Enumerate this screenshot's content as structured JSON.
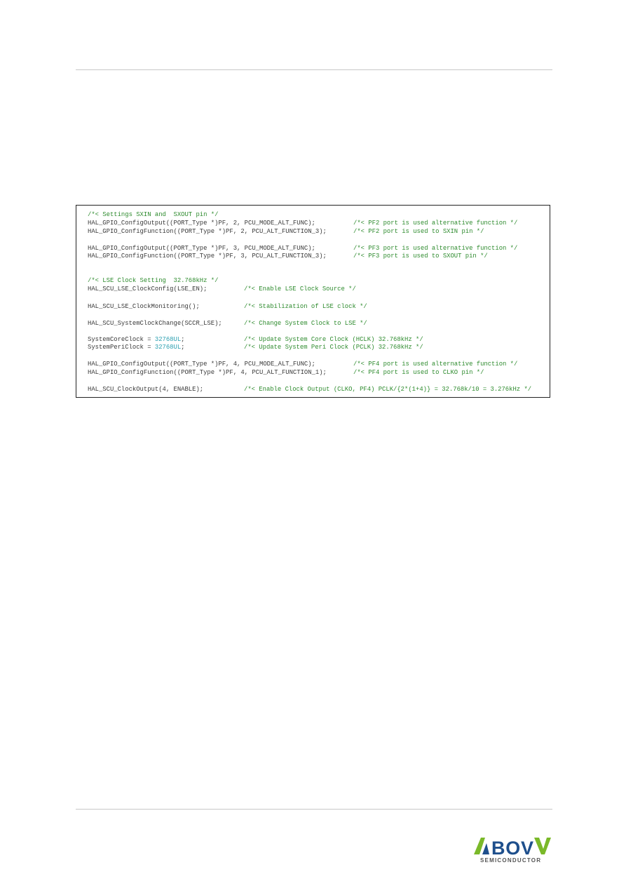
{
  "code_block": {
    "lines": [
      {
        "code": "",
        "comment": "/*< Settings SXIN and  SXOUT pin */"
      },
      {
        "code": "HAL_GPIO_ConfigOutput((PORT_Type *)PF, 2, PCU_MODE_ALT_FUNC);",
        "comment": "/*< PF2 port is used alternative function */"
      },
      {
        "code": "HAL_GPIO_ConfigFunction((PORT_Type *)PF, 2, PCU_ALT_FUNCTION_3);",
        "comment": "/*< PF2 port is used to SXIN pin */"
      },
      {
        "code": "HAL_GPIO_ConfigOutput((PORT_Type *)PF, 3, PCU_MODE_ALT_FUNC);",
        "comment": "/*< PF3 port is used alternative function */"
      },
      {
        "code": "HAL_GPIO_ConfigFunction((PORT_Type *)PF, 3, PCU_ALT_FUNCTION_3);",
        "comment": "/*< PF3 port is used to SXOUT pin */"
      },
      {
        "code": "",
        "comment": "/*< LSE Clock Setting  32.768kHz */"
      },
      {
        "code": "HAL_SCU_LSE_ClockConfig(LSE_EN);",
        "comment": "/*< Enable LSE Clock Source */"
      },
      {
        "code": "HAL_SCU_LSE_ClockMonitoring();",
        "comment": "/*< Stabilization of LSE clock */"
      },
      {
        "code": "HAL_SCU_SystemClockChange(SCCR_LSE);",
        "comment": "/*< Change System Clock to LSE */"
      },
      {
        "code": "SystemCoreClock = ",
        "value": "32768UL",
        "tail": ";",
        "comment": "/*< Update System Core Clock (HCLK) 32.768kHz */"
      },
      {
        "code": "SystemPeriClock = ",
        "value": "32768UL",
        "tail": ";",
        "comment": "/*< Update System Peri Clock (PCLK) 32.768kHz */"
      },
      {
        "code": "HAL_GPIO_ConfigOutput((PORT_Type *)PF, 4, PCU_MODE_ALT_FUNC);",
        "comment": "/*< PF4 port is used alternative function */"
      },
      {
        "code": "HAL_GPIO_ConfigFunction((PORT_Type *)PF, 4, PCU_ALT_FUNCTION_1);",
        "comment": "/*< PF4 port is used to CLKO pin */"
      },
      {
        "code": "HAL_SCU_ClockOutput(4, ENABLE);",
        "comment": "/*< Enable Clock Output (CLKO, PF4) PCLK/{2*(1+4)} = 32.768k/10 = 3.276kHz */"
      }
    ]
  },
  "colors": {
    "comment": "#2e8b2e",
    "number": "#2a9fb0",
    "logo_green": "#7ab929",
    "logo_blue": "#1e4f8c"
  },
  "footer": {
    "logo_text": "ABOV",
    "logo_subtext": "SEMICONDUCTOR"
  }
}
